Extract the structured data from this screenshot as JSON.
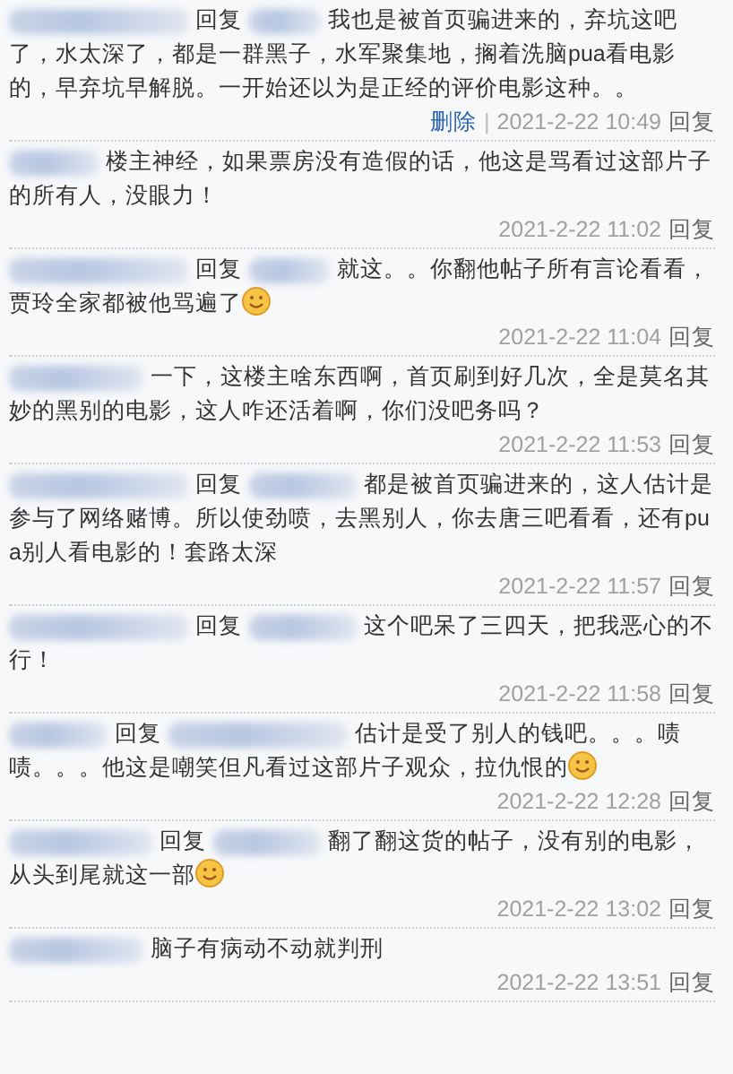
{
  "comments": [
    {
      "reply_label": "回复",
      "text": "我也是被首页骗进来的，弃坑这吧了，水太深了，都是一群黑子，水军聚集地，搁着洗脑pua看电影的，早弃坑早解脱。一开始还以为是正经的评价电影这种。。",
      "emoji": false,
      "delete": "删除",
      "separator": "|",
      "time": "2021-2-22 10:49",
      "action": "回复"
    },
    {
      "text": "楼主神经，如果票房没有造假的话，他这是骂看过这部片子的所有人，没眼力！",
      "emoji": false,
      "time": "2021-2-22 11:02",
      "action": "回复"
    },
    {
      "reply_label": "回复",
      "text": "就这。。你翻他帖子所有言论看看，贾玲全家都被他骂遍了",
      "emoji": true,
      "time": "2021-2-22 11:04",
      "action": "回复"
    },
    {
      "text": "一下，这楼主啥东西啊，首页刷到好几次，全是莫名其妙的黑别的电影，这人咋还活着啊，你们没吧务吗？",
      "emoji": false,
      "time": "2021-2-22 11:53",
      "action": "回复"
    },
    {
      "reply_label": "回复",
      "text": "都是被首页骗进来的，这人估计是参与了网络赌博。所以使劲喷，去黑别人，你去唐三吧看看，还有pua别人看电影的！套路太深",
      "emoji": false,
      "time": "2021-2-22 11:57",
      "action": "回复"
    },
    {
      "reply_label": "回复",
      "text": "这个吧呆了三四天，把我恶心的不行！",
      "emoji": false,
      "time": "2021-2-22 11:58",
      "action": "回复"
    },
    {
      "reply_label": "回复",
      "text": "估计是受了别人的钱吧。。。啧啧。。。他这是嘲笑但凡看过这部片子观众，拉仇恨的",
      "emoji": true,
      "time": "2021-2-22 12:28",
      "action": "回复"
    },
    {
      "reply_label": "回复",
      "text": "翻了翻这货的帖子，没有别的电影，从头到尾就这一部",
      "emoji": true,
      "time": "2021-2-22 13:02",
      "action": "回复"
    },
    {
      "text": "脑子有病动不动就判刑",
      "emoji": false,
      "time": "2021-2-22 13:51",
      "action": "回复"
    }
  ]
}
